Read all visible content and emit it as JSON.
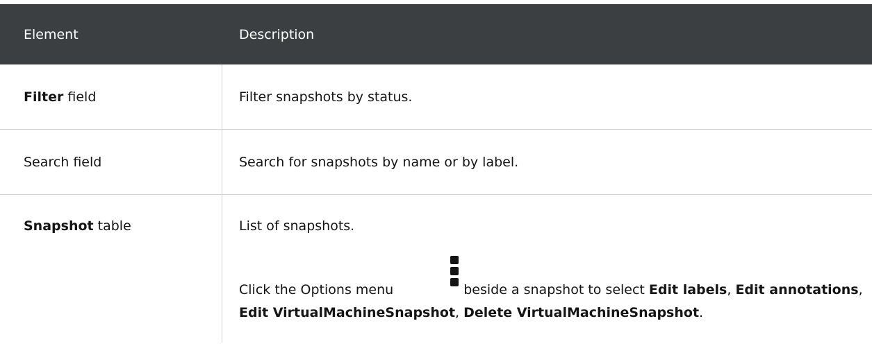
{
  "header": {
    "element": "Element",
    "description": "Description"
  },
  "rows": [
    {
      "element_bold": "Filter",
      "element_rest": " field",
      "description": "Filter snapshots by status."
    },
    {
      "element_bold": "",
      "element_rest": "Search field",
      "description": "Search for snapshots by name or by label."
    },
    {
      "element_bold": "Snapshot",
      "element_rest": " table",
      "description": "List of snapshots.",
      "options_prefix": "Click the Options menu",
      "options_mid": " beside a snapshot to select ",
      "menu_items": [
        "Edit labels",
        "Edit annotations",
        "Edit VirtualMachineSnapshot",
        "Delete VirtualMachineSnapshot"
      ],
      "kebab_icon": "kebab-menu-icon"
    }
  ]
}
